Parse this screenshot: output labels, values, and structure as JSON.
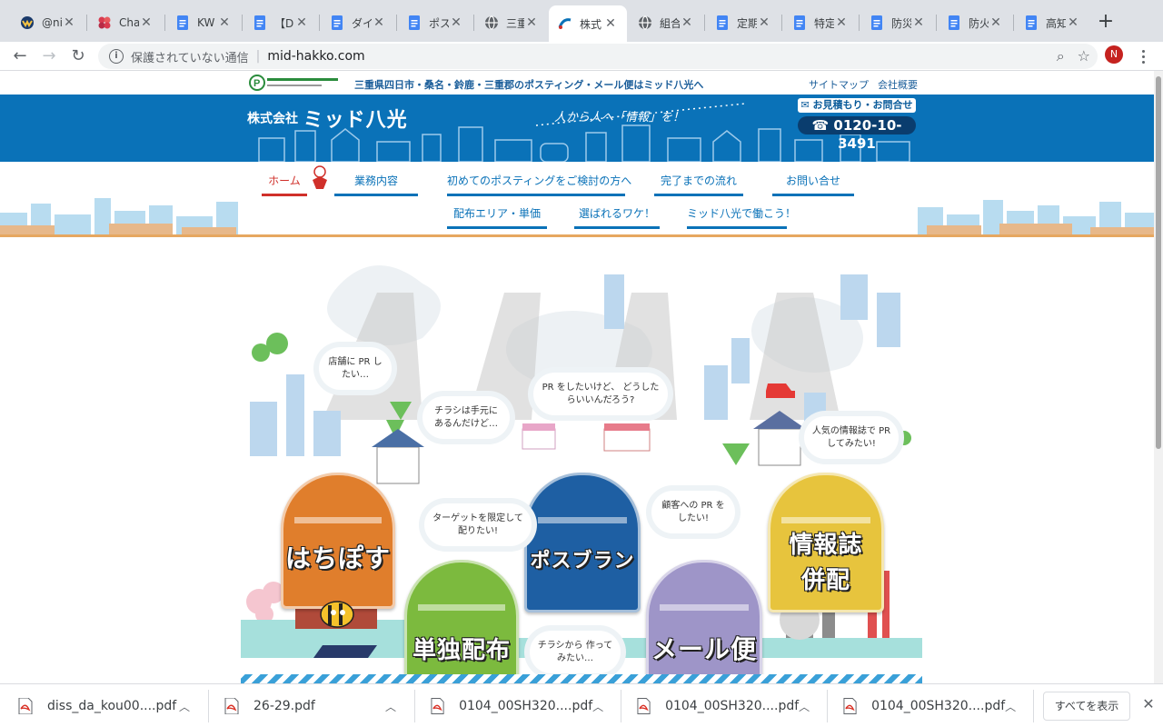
{
  "browser": {
    "tabs": [
      {
        "title": "@ni",
        "icon": "wayground-icon"
      },
      {
        "title": "Cha",
        "icon": "chart-icon"
      },
      {
        "title": "KW",
        "icon": "docs-icon"
      },
      {
        "title": "【D",
        "icon": "docs-icon"
      },
      {
        "title": "ダイ",
        "icon": "docs-icon"
      },
      {
        "title": "ポス",
        "icon": "docs-icon"
      },
      {
        "title": "三重",
        "icon": "globe-icon"
      },
      {
        "title": "株式",
        "icon": "site-icon",
        "active": true
      },
      {
        "title": "組合",
        "icon": "globe-icon"
      },
      {
        "title": "定期",
        "icon": "docs-icon"
      },
      {
        "title": "特定",
        "icon": "docs-icon"
      },
      {
        "title": "防災",
        "icon": "docs-icon"
      },
      {
        "title": "防火",
        "icon": "docs-icon"
      },
      {
        "title": "高知",
        "icon": "docs-icon"
      }
    ],
    "new_tab": "+",
    "address": {
      "security_label": "保護されていない通信",
      "url": "mid-hakko.com"
    },
    "profile_initial": "N"
  },
  "site": {
    "tagline": "三重県四日市・桑名・鈴鹿・三重郡のポスティング・メール便はミッド八光へ",
    "top_links": [
      "サイトマップ",
      "会社概要"
    ],
    "logo_prefix": "株式会社",
    "logo_name": "ミッド八光",
    "slogan": "人から人へ「情報」を！",
    "contact_label": "お見積もり・お問合せ",
    "phone": "0120-10-3491",
    "nav_row1": [
      "ホーム",
      "業務内容",
      "初めてのポスティングをご検討の方へ",
      "完了までの流れ",
      "お問い合せ"
    ],
    "nav_row2": [
      "配布エリア・単価",
      "選ばれるワケ！",
      "ミッド八光で働こう！"
    ]
  },
  "hero": {
    "posts": [
      {
        "label": "はちぽす",
        "color": "#e07e2c"
      },
      {
        "label": "単独配布",
        "color": "#7cba3e"
      },
      {
        "label": "ポスブラン",
        "color": "#1e5fa3"
      },
      {
        "label": "メール便",
        "color": "#9e95c8"
      },
      {
        "label": "情報誌 併配",
        "color": "#e7c43d"
      }
    ],
    "bubbles": [
      "店舗に PR したい…",
      "チラシは手元に あるんだけど…",
      "PR をしたいけど、 どうしたらいいんだろう?",
      "人気の情報誌で PR してみたい!",
      "ターゲットを限定して 配りたい!",
      "顧客への PR をしたい!",
      "チラシから 作ってみたい…"
    ]
  },
  "downloads": {
    "items": [
      "diss_da_kou00....pdf",
      "26-29.pdf",
      "0104_00SH320....pdf",
      "0104_00SH320....pdf",
      "0104_00SH320....pdf"
    ],
    "show_all": "すべてを表示"
  }
}
